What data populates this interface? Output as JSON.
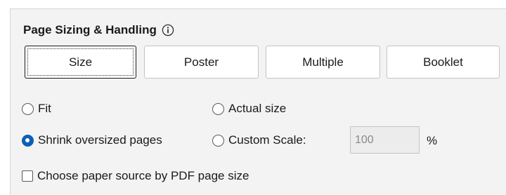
{
  "section": {
    "title": "Page Sizing & Handling",
    "info_icon": "info-circle-icon"
  },
  "mode_buttons": [
    {
      "label": "Size",
      "active": true
    },
    {
      "label": "Poster",
      "active": false
    },
    {
      "label": "Multiple",
      "active": false
    },
    {
      "label": "Booklet",
      "active": false
    }
  ],
  "options": {
    "fit": {
      "label": "Fit",
      "checked": false
    },
    "actual_size": {
      "label": "Actual size",
      "checked": false
    },
    "shrink": {
      "label": "Shrink oversized pages",
      "checked": true
    },
    "custom_scale": {
      "label": "Custom Scale:",
      "checked": false
    }
  },
  "scale": {
    "value": "100",
    "unit": "%"
  },
  "paper_source": {
    "label": "Choose paper source by PDF page size",
    "checked": false
  },
  "colors": {
    "accent": "#0b5fb5",
    "panel_bg": "#f3f3f3"
  }
}
